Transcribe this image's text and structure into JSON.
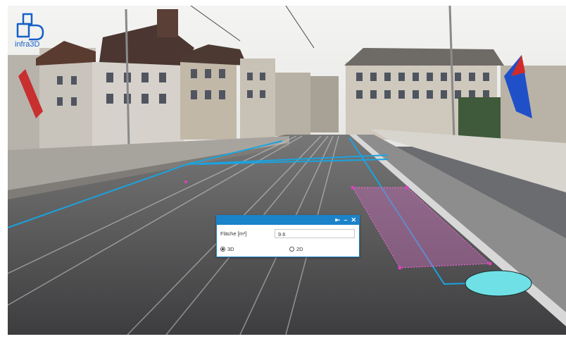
{
  "app": {
    "logo_text": "infra3D"
  },
  "measure_dialog": {
    "controls": {
      "pin": "⇤",
      "minimize": "–",
      "close": "✕"
    },
    "field_label": "Fläche [m²]",
    "field_value": "9.6",
    "options": [
      {
        "label": "3D",
        "checked": true
      },
      {
        "label": "2D",
        "checked": false
      }
    ]
  },
  "colors": {
    "measure_line": "#1ba3df",
    "area_fill": "#c06ab4",
    "area_vertex": "#e040c0",
    "ellipse_fill": "#6fe0e6",
    "titlebar": "#1a83c9"
  },
  "icons": [
    "infra3d-logo",
    "pin-icon",
    "minimize-icon",
    "close-icon"
  ]
}
